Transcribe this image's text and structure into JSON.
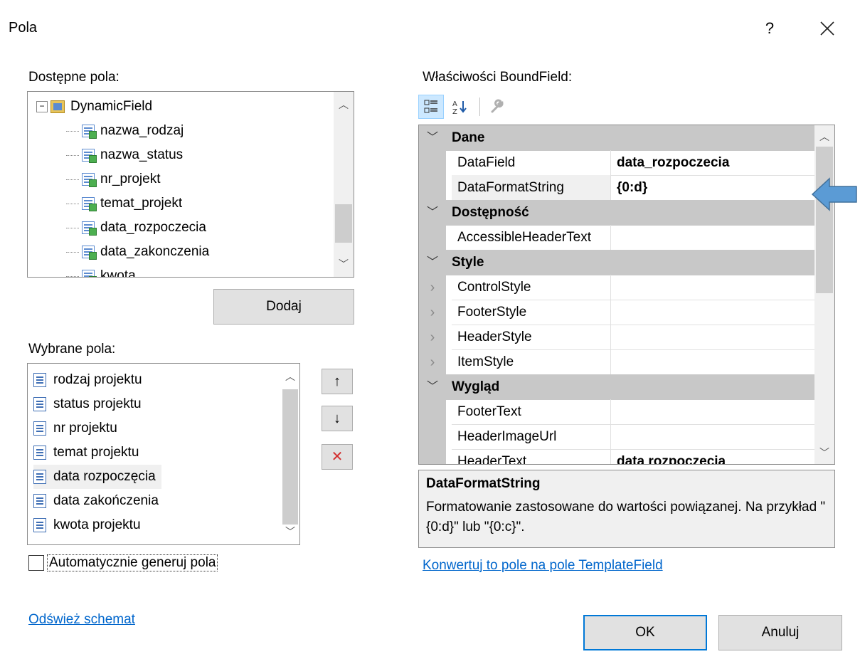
{
  "dialog": {
    "title": "Pola",
    "help_label": "?",
    "close_label": "×"
  },
  "available": {
    "label": "Dostępne pola:",
    "root": "DynamicField",
    "items": [
      "nazwa_rodzaj",
      "nazwa_status",
      "nr_projekt",
      "temat_projekt",
      "data_rozpoczecia",
      "data_zakonczenia",
      "kwota"
    ]
  },
  "add_button": "Dodaj",
  "selected": {
    "label": "Wybrane pola:",
    "items": [
      "rodzaj projektu",
      "status projektu",
      "nr projektu",
      "temat projektu",
      "data rozpoczęcia",
      "data zakończenia",
      "kwota projektu"
    ],
    "selected_index": 4
  },
  "move_buttons": {
    "up": "↑",
    "down": "↓",
    "delete": "✕"
  },
  "auto_generate": {
    "label": "Automatycznie generuj pola",
    "checked": false
  },
  "refresh_link": "Odśwież schemat",
  "properties": {
    "label": "Właściwości BoundField:",
    "categories": [
      {
        "name": "Dane",
        "rows": [
          {
            "name": "DataField",
            "value": "data_rozpoczecia"
          },
          {
            "name": "DataFormatString",
            "value": "{0:d}"
          }
        ]
      },
      {
        "name": "Dostępność",
        "rows": [
          {
            "name": "AccessibleHeaderText",
            "value": ""
          }
        ]
      },
      {
        "name": "Style",
        "rows": [
          {
            "name": "ControlStyle",
            "value": ""
          },
          {
            "name": "FooterStyle",
            "value": ""
          },
          {
            "name": "HeaderStyle",
            "value": ""
          },
          {
            "name": "ItemStyle",
            "value": ""
          }
        ]
      },
      {
        "name": "Wygląd",
        "rows": [
          {
            "name": "FooterText",
            "value": ""
          },
          {
            "name": "HeaderImageUrl",
            "value": ""
          },
          {
            "name": "HeaderText",
            "value": "data rozpoczecia"
          }
        ]
      }
    ]
  },
  "description": {
    "title": "DataFormatString",
    "text": "Formatowanie zastosowane do wartości powiązanej. Na przykład \"{0:d}\" lub \"{0:c}\"."
  },
  "convert_link": "Konwertuj to pole na pole TemplateField",
  "ok_button": "OK",
  "cancel_button": "Anuluj",
  "colors": {
    "accent": "#0078d7",
    "link": "#0066cc",
    "pointer": "#5b9bd5",
    "delete": "#d32f2f"
  }
}
